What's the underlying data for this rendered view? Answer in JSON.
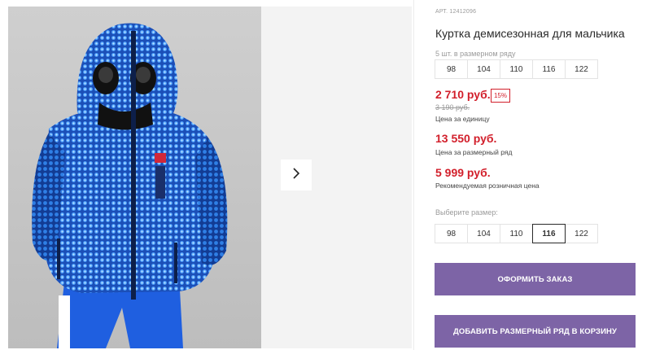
{
  "gallery": {
    "photo_alt": "child in blue jacket",
    "next_icon": "chevron-right-icon"
  },
  "product": {
    "sku": "АРТ. 12412096",
    "title": "Куртка демисезонная для мальчика",
    "pack_note": "5 шт. в размерном ряду",
    "pack_sizes": [
      "98",
      "104",
      "110",
      "116",
      "122"
    ],
    "price_unit": "2 710 руб.",
    "discount": "15%",
    "old_price": "3 190 руб.",
    "price_unit_caption": "Цена за единицу",
    "price_pack": "13 550 руб.",
    "price_pack_caption": "Цена за размерный ряд",
    "price_rrp": "5 999 руб.",
    "price_rrp_caption": "Рекомендуемая розничная цена",
    "choose_size_label": "Выберите размер:",
    "sizes": [
      "98",
      "104",
      "110",
      "116",
      "122"
    ],
    "selected_size": "116"
  },
  "actions": {
    "order_label": "ОФОРМИТЬ ЗАКАЗ",
    "add_pack_label": "ДОБАВИТЬ РАЗМЕРНЫЙ РЯД В КОРЗИНУ"
  },
  "colors": {
    "accent": "#7d64a6",
    "price_red": "#d21f2b"
  }
}
